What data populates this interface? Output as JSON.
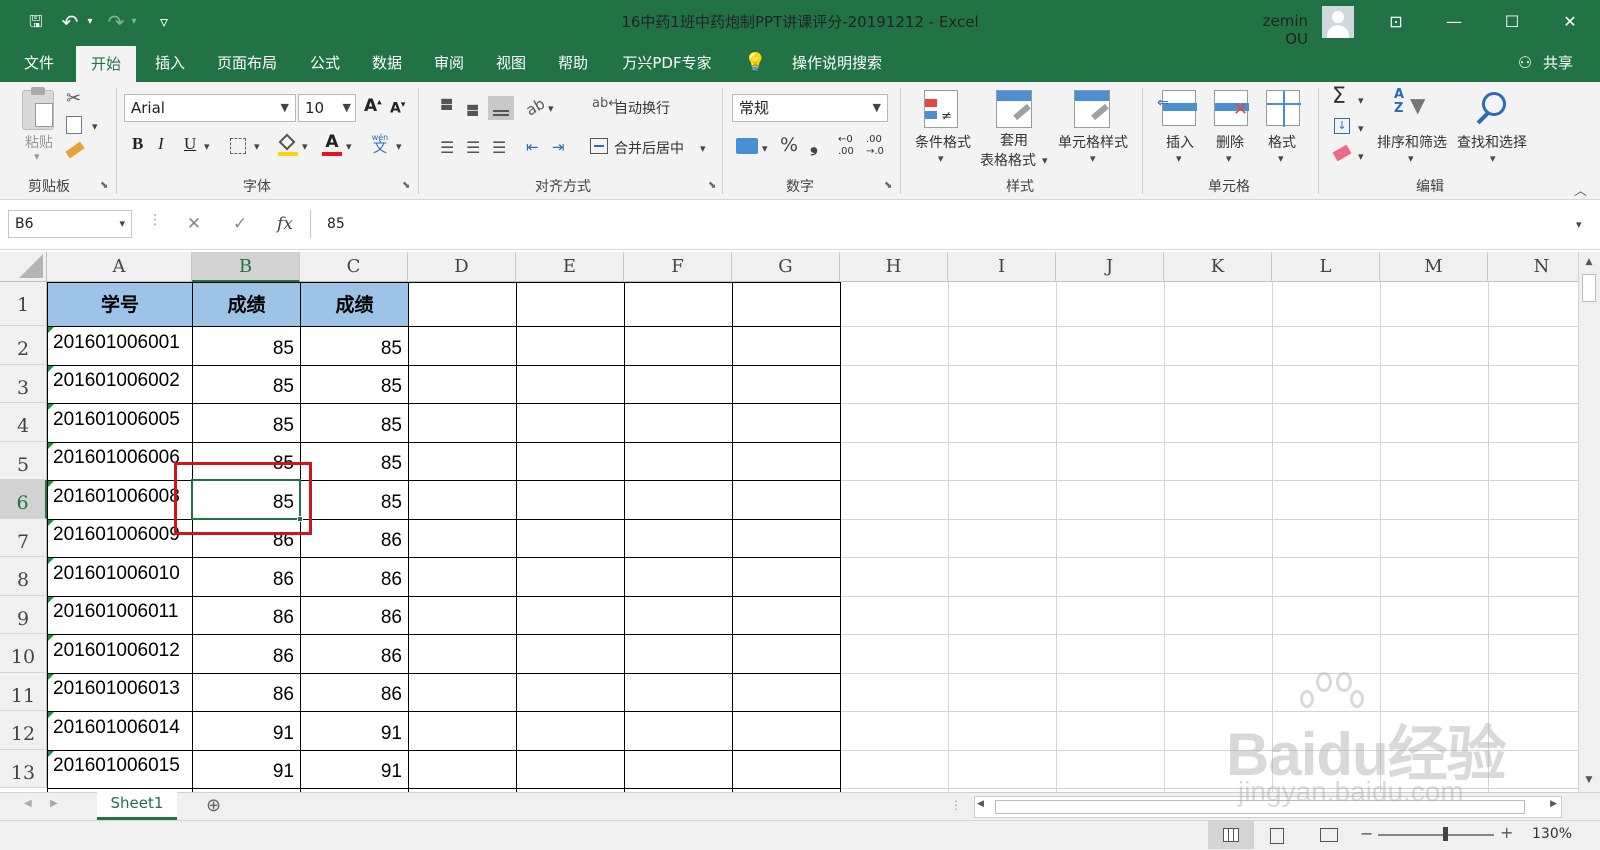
{
  "title": "16中药1班中药炮制PPT讲课评分-20191212  -  Excel",
  "user": "zemin OU",
  "window_controls": {
    "restore_ribbon": "⊡",
    "minimize": "—",
    "maximize": "☐",
    "close": "✕"
  },
  "qat": {
    "save": "🖫",
    "undo": "↶",
    "redo": "↷",
    "customize": "▿"
  },
  "tabs": [
    "文件",
    "开始",
    "插入",
    "页面布局",
    "公式",
    "数据",
    "审阅",
    "视图",
    "帮助",
    "万兴PDF专家"
  ],
  "tell_me": "操作说明搜索",
  "share": "共享",
  "ribbon": {
    "clipboard": {
      "paste": "粘贴",
      "label": "剪贴板"
    },
    "font": {
      "name": "Arial",
      "size": "10",
      "bold": "B",
      "italic": "I",
      "underline": "U",
      "font_color_glyph": "A",
      "phonetic_top": "wén",
      "phonetic_bottom": "文",
      "grow": "A",
      "shrink": "A",
      "label": "字体"
    },
    "alignment": {
      "wrap": "自动换行",
      "merge": "合并后居中",
      "label": "对齐方式"
    },
    "number": {
      "format": "常规",
      "percent": "%",
      "comma": "❟",
      "inc_top": "←0",
      "inc_bottom": ".00",
      "dec_top": ".00",
      "dec_bottom": "→.0",
      "label": "数字"
    },
    "styles": {
      "conditional": "条件格式",
      "table_top": "套用",
      "table_bottom": "表格格式",
      "cell_styles": "单元格样式",
      "label": "样式"
    },
    "cells": {
      "insert": "插入",
      "delete": "删除",
      "format": "格式",
      "label": "单元格"
    },
    "editing": {
      "sum": "Σ",
      "sort": "排序和筛选",
      "find": "查找和选择",
      "label": "编辑"
    }
  },
  "formula_bar": {
    "name_box": "B6",
    "cancel": "✕",
    "enter": "✓",
    "fx": "fx",
    "value": "85"
  },
  "columns": [
    "A",
    "B",
    "C",
    "D",
    "E",
    "F",
    "G",
    "H",
    "I",
    "J",
    "K",
    "L",
    "M",
    "N"
  ],
  "rows": [
    "1",
    "2",
    "3",
    "4",
    "5",
    "6",
    "7",
    "8",
    "9",
    "10",
    "11",
    "12",
    "13"
  ],
  "headers": [
    "学号",
    "成绩",
    "成绩"
  ],
  "data": [
    [
      "201601006001",
      "85",
      "85"
    ],
    [
      "201601006002",
      "85",
      "85"
    ],
    [
      "201601006005",
      "85",
      "85"
    ],
    [
      "201601006006",
      "85",
      "85"
    ],
    [
      "201601006008",
      "85",
      "85"
    ],
    [
      "201601006009",
      "86",
      "86"
    ],
    [
      "201601006010",
      "86",
      "86"
    ],
    [
      "201601006011",
      "86",
      "86"
    ],
    [
      "201601006012",
      "86",
      "86"
    ],
    [
      "201601006013",
      "86",
      "86"
    ],
    [
      "201601006014",
      "91",
      "91"
    ],
    [
      "201601006015",
      "91",
      "91"
    ]
  ],
  "selected_cell": "B6",
  "sheet_tab": "Sheet1",
  "add_sheet": "⊕",
  "zoom": "130%",
  "watermark": {
    "brand": "Baidu经验",
    "url": "jingyan.baidu.com"
  },
  "colors": {
    "excel_green": "#217346",
    "header_fill": "#9dc3e6",
    "highlight_red": "#d0141b"
  }
}
